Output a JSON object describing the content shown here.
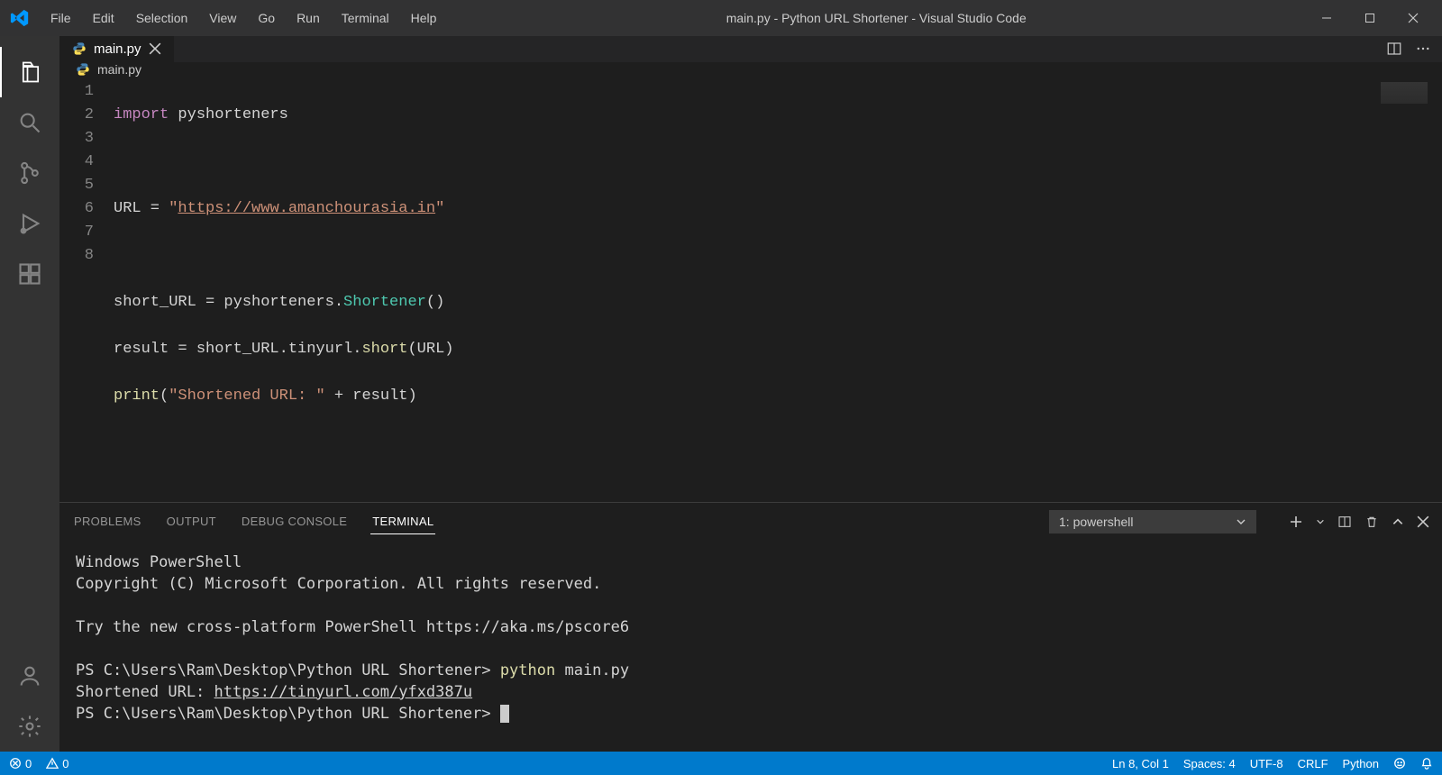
{
  "titlebar": {
    "menus": [
      "File",
      "Edit",
      "Selection",
      "View",
      "Go",
      "Run",
      "Terminal",
      "Help"
    ],
    "title": "main.py - Python URL Shortener - Visual Studio Code"
  },
  "tabs": [
    {
      "label": "main.py"
    }
  ],
  "breadcrumb": {
    "filename": "main.py"
  },
  "editor": {
    "line_numbers": [
      "1",
      "2",
      "3",
      "4",
      "5",
      "6",
      "7",
      "8"
    ],
    "code": {
      "l1_import": "import",
      "l1_mod": " pyshorteners",
      "l3_a": "URL = ",
      "l3_q1": "\"",
      "l3_url": "https://www.amanchourasia.in",
      "l3_q2": "\"",
      "l5": "short_URL = pyshorteners.",
      "l5_cls": "Shortener",
      "l5_paren": "()",
      "l6": "result = short_URL.tinyurl.",
      "l6_fn": "short",
      "l6_arg": "(URL)",
      "l7_print": "print",
      "l7_open": "(",
      "l7_str": "\"Shortened URL: \"",
      "l7_rest": " + result)"
    }
  },
  "panel": {
    "tabs": [
      "PROBLEMS",
      "OUTPUT",
      "DEBUG CONSOLE",
      "TERMINAL"
    ],
    "active_tab": "TERMINAL",
    "terminal_selector": "1: powershell",
    "terminal": {
      "line1": "Windows PowerShell",
      "line2": "Copyright (C) Microsoft Corporation. All rights reserved.",
      "line3": "Try the new cross-platform PowerShell https://aka.ms/pscore6",
      "prompt1": "PS C:\\Users\\Ram\\Desktop\\Python URL Shortener> ",
      "cmd1a": "python",
      "cmd1b": " main.py",
      "out1a": "Shortened URL: ",
      "out1b": "https://tinyurl.com/yfxd387u",
      "prompt2": "PS C:\\Users\\Ram\\Desktop\\Python URL Shortener> "
    }
  },
  "status": {
    "errors": "0",
    "warnings": "0",
    "cursor": "Ln 8, Col 1",
    "spaces": "Spaces: 4",
    "encoding": "UTF-8",
    "eol": "CRLF",
    "lang": "Python"
  }
}
